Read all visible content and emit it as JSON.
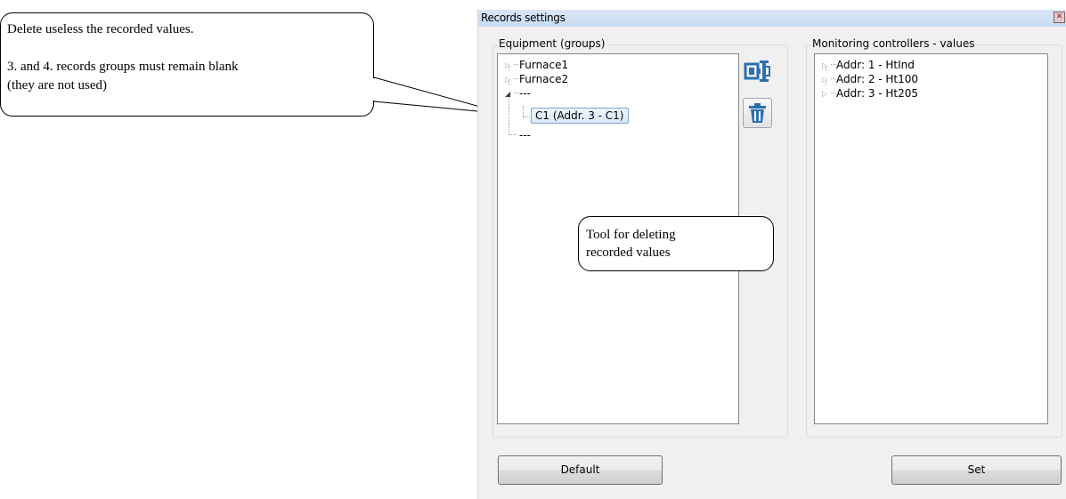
{
  "callouts": {
    "top_line1": "Delete useless the  recorded values.",
    "top_line2": "3. and 4. records groups must remain blank",
    "top_line3": "(they are not used)",
    "tool_line1": "Tool for deleting",
    "tool_line2": "recorded values"
  },
  "dialog": {
    "title": "Records settings",
    "close_glyph": "✕"
  },
  "equipment": {
    "label": "Equipment (groups)",
    "items": [
      "Furnace1",
      "Furnace2",
      "---",
      "C1 (Addr. 3 - C1)",
      "---"
    ]
  },
  "monitoring": {
    "label": "Monitoring controllers - values",
    "items": [
      "Addr: 1 - HtInd",
      "Addr: 2 - Ht100",
      "Addr: 3 - Ht205"
    ]
  },
  "tools": {
    "edit_icon": "edit-record-icon",
    "delete_icon": "trash-icon"
  },
  "buttons": {
    "default_label": "Default",
    "set_label": "Set"
  },
  "colors": {
    "icon_blue": "#2a6fb0",
    "selection_border": "#7da2ce"
  }
}
